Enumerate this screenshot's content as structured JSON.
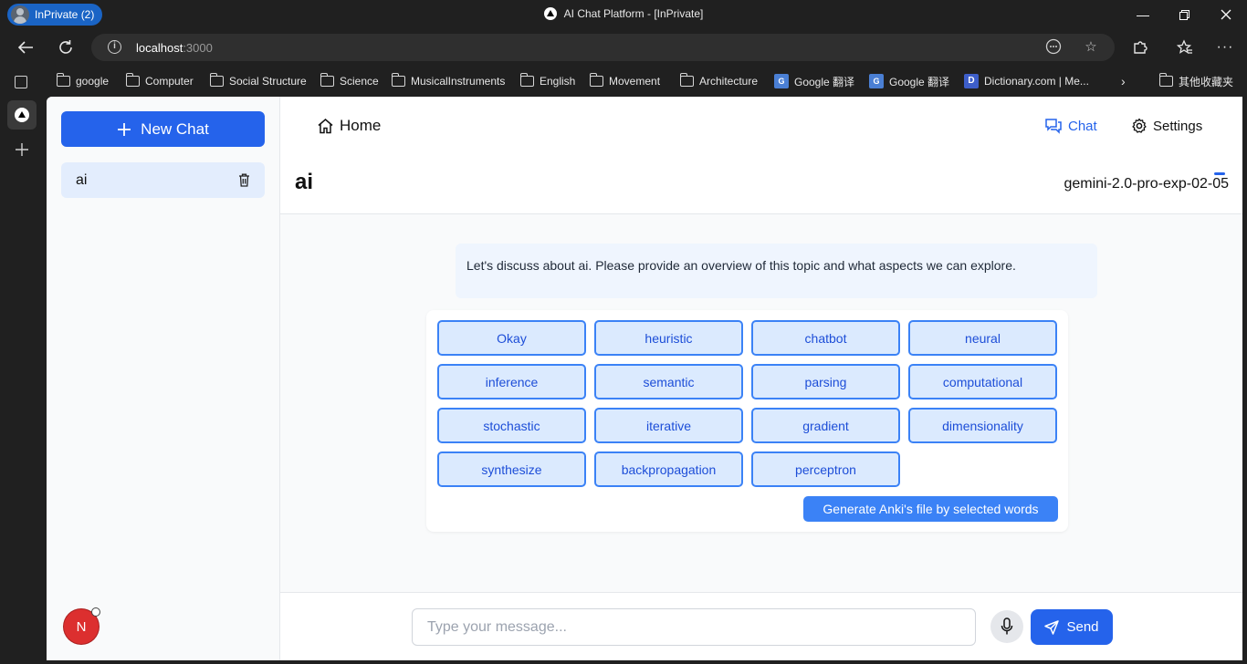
{
  "browser": {
    "profile_label": "InPrivate (2)",
    "window_title": "AI Chat Platform - [InPrivate]",
    "url_host": "localhost",
    "url_port": ":3000",
    "bookmarks": [
      {
        "label": "google",
        "icon": "folder-icon"
      },
      {
        "label": "Computer",
        "icon": "folder-icon"
      },
      {
        "label": "Social Structure",
        "icon": "folder-icon"
      },
      {
        "label": "Science",
        "icon": "folder-icon"
      },
      {
        "label": "MusicalInstruments",
        "icon": "folder-icon"
      },
      {
        "label": "English",
        "icon": "folder-icon"
      },
      {
        "label": "Movement",
        "icon": "folder-icon"
      },
      {
        "label": "Architecture",
        "icon": "folder-icon"
      },
      {
        "label": "Google 翻译",
        "icon": "google-translate-icon"
      },
      {
        "label": "Google 翻译",
        "icon": "google-translate-icon"
      },
      {
        "label": "Dictionary.com | Me...",
        "icon": "dictionary-icon"
      }
    ],
    "other_bookmarks": "其他收藏夹"
  },
  "sidebar": {
    "new_chat_label": "New Chat",
    "chats": [
      {
        "label": "ai"
      }
    ],
    "user_initial": "N"
  },
  "nav": {
    "home_label": "Home",
    "chat_label": "Chat",
    "settings_label": "Settings"
  },
  "header": {
    "title": "ai",
    "model": "gemini-2.0-pro-exp-02-05"
  },
  "chat": {
    "message": "Let's discuss about ai. Please provide an overview of this topic and what aspects we can explore.",
    "words": [
      "Okay",
      "heuristic",
      "chatbot",
      "neural",
      "inference",
      "semantic",
      "parsing",
      "computational",
      "stochastic",
      "iterative",
      "gradient",
      "dimensionality",
      "synthesize",
      "backpropagation",
      "perceptron"
    ],
    "anki_button": "Generate Anki's file by selected words"
  },
  "composer": {
    "placeholder": "Type your message...",
    "value": "",
    "send_label": "Send"
  },
  "colors": {
    "accent": "#2563eb",
    "word_bg": "#dbeafe",
    "word_border": "#3b82f6",
    "message_bg": "#eff5fe"
  }
}
